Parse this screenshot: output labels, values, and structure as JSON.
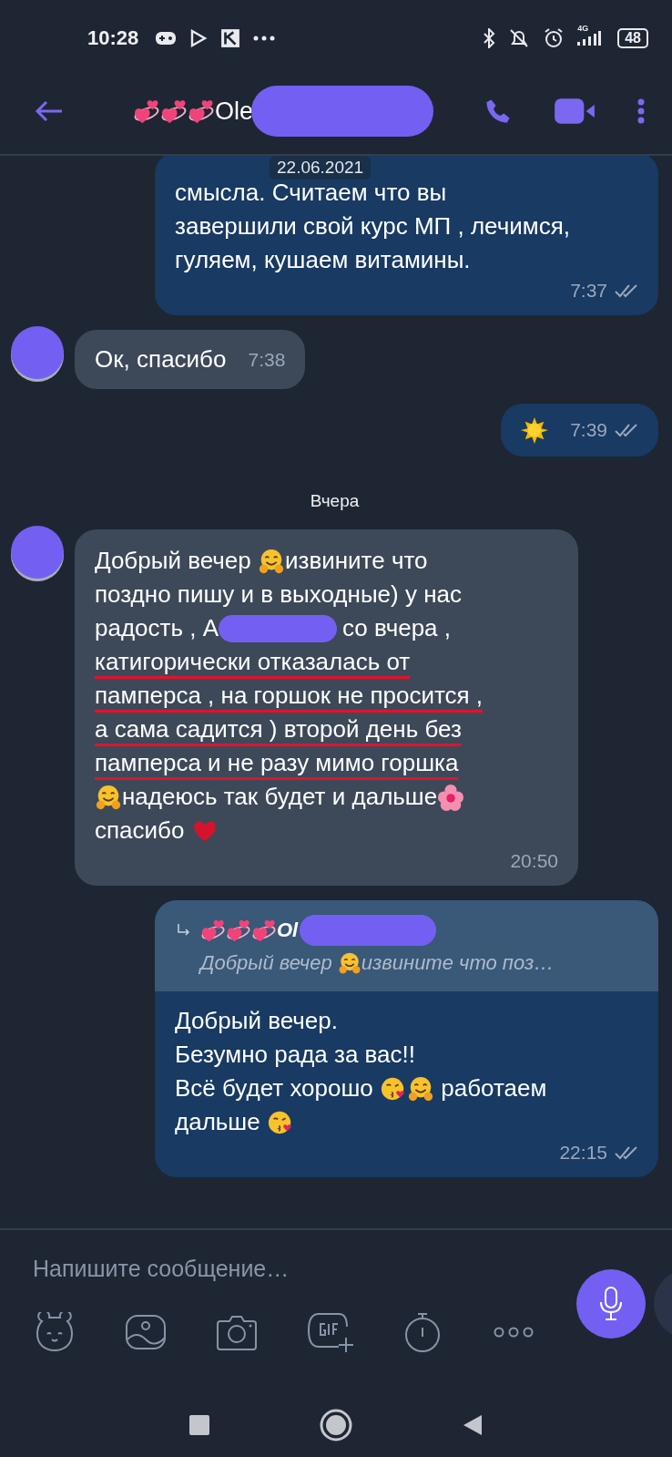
{
  "status_bar": {
    "time": "10:28",
    "network": "4G",
    "battery": "48"
  },
  "header": {
    "title": [
      {
        "kind": "hearts"
      },
      {
        "kind": "hearts"
      },
      {
        "kind": "hearts"
      },
      {
        "text": "Ole"
      },
      {
        "kind": "redaction"
      }
    ]
  },
  "date_badge": "22.06.2021",
  "messages": [
    {
      "kind": "outgoing",
      "time": "7:37",
      "delivered": true,
      "lines": [
        {
          "segs": [
            {
              "text": "смысла. Считаем что вы"
            }
          ]
        },
        {
          "segs": [
            {
              "text": "завершили свой курс МП , лечимся,"
            }
          ]
        },
        {
          "segs": [
            {
              "text": "гуляем, кушаем витамины."
            }
          ]
        }
      ]
    },
    {
      "kind": "incoming",
      "time": "7:38",
      "lines": [
        {
          "segs": [
            {
              "text": "Ок, спасибо"
            }
          ]
        }
      ]
    },
    {
      "kind": "outgoing",
      "time": "7:39",
      "delivered": true,
      "lines": [
        {
          "segs": [
            {
              "kind": "sun"
            }
          ]
        }
      ]
    },
    {
      "kind": "date",
      "text": "Вчера"
    },
    {
      "kind": "incoming",
      "time": "20:50",
      "lines": [
        {
          "underlined": false,
          "segs": [
            {
              "text": "Добрый вечер "
            },
            {
              "kind": "hug"
            },
            {
              "text": "извините что"
            }
          ]
        },
        {
          "underlined": false,
          "segs": [
            {
              "text": "поздно пишу и в выходные) у нас"
            }
          ]
        },
        {
          "underlined": false,
          "segs": [
            {
              "text": "радость , А"
            },
            {
              "kind": "redaction"
            },
            {
              "text": "со вчера ,"
            }
          ]
        },
        {
          "underlined": true,
          "segs": [
            {
              "text": "катигорически отказалась от"
            }
          ]
        },
        {
          "underlined": true,
          "segs": [
            {
              "text": "памперса , на горшок не просится ,"
            }
          ]
        },
        {
          "underlined": true,
          "segs": [
            {
              "text": "а сама садится ) второй день без"
            }
          ]
        },
        {
          "underlined": true,
          "segs": [
            {
              "text": "памперса и не разу мимо горшка"
            }
          ]
        },
        {
          "underlined": false,
          "segs": [
            {
              "kind": "hug"
            },
            {
              "text": "надеюсь так будет и дальше"
            },
            {
              "kind": "flower"
            }
          ]
        },
        {
          "underlined": false,
          "segs": [
            {
              "text": "спасибо "
            },
            {
              "kind": "heart"
            }
          ]
        }
      ]
    },
    {
      "kind": "outgoing",
      "time": "22:15",
      "delivered": true,
      "reply": {
        "name": [
          {
            "kind": "hearts"
          },
          {
            "kind": "hearts"
          },
          {
            "kind": "hearts"
          },
          {
            "text": "Ol"
          },
          {
            "kind": "redaction"
          }
        ],
        "quote": [
          {
            "text": "Добрый вечер "
          },
          {
            "kind": "hug"
          },
          {
            "text": "извините что поз…"
          }
        ]
      },
      "lines": [
        {
          "segs": [
            {
              "text": "Добрый вечер."
            }
          ]
        },
        {
          "segs": [
            {
              "text": "Безумно рада за вас!!"
            }
          ]
        },
        {
          "segs": [
            {
              "text": "Всё будет хорошо "
            },
            {
              "kind": "kiss"
            },
            {
              "kind": "hug"
            },
            {
              "text": " работаем"
            }
          ]
        },
        {
          "segs": [
            {
              "text": "дальше "
            },
            {
              "kind": "kiss"
            }
          ]
        }
      ]
    }
  ],
  "composer": {
    "placeholder": "Напишите сообщение…"
  }
}
